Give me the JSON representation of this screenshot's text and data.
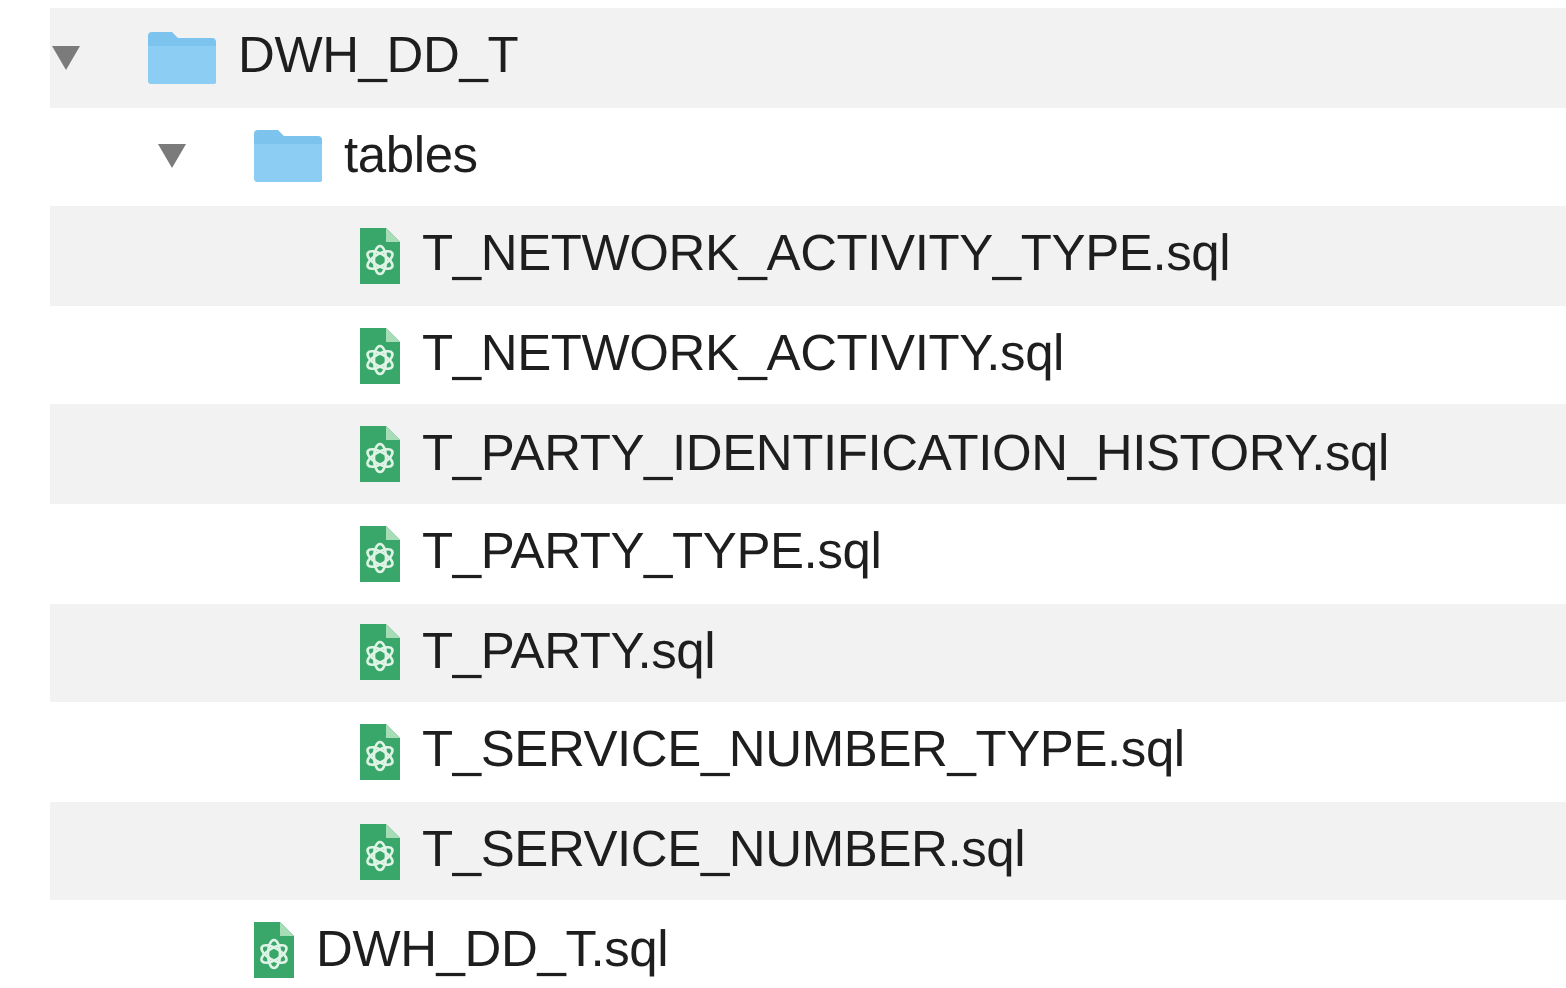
{
  "tree": [
    {
      "name": "DWH_DD_T",
      "kind": "folder",
      "expanded": true,
      "children": [
        {
          "name": "tables",
          "kind": "folder",
          "expanded": true,
          "children": [
            {
              "name": "T_NETWORK_ACTIVITY_TYPE.sql",
              "kind": "file"
            },
            {
              "name": "T_NETWORK_ACTIVITY.sql",
              "kind": "file"
            },
            {
              "name": "T_PARTY_IDENTIFICATION_HISTORY.sql",
              "kind": "file"
            },
            {
              "name": "T_PARTY_TYPE.sql",
              "kind": "file"
            },
            {
              "name": "T_PARTY.sql",
              "kind": "file"
            },
            {
              "name": "T_SERVICE_NUMBER_TYPE.sql",
              "kind": "file"
            },
            {
              "name": "T_SERVICE_NUMBER.sql",
              "kind": "file"
            }
          ]
        },
        {
          "name": "DWH_DD_T.sql",
          "kind": "file"
        }
      ]
    }
  ]
}
